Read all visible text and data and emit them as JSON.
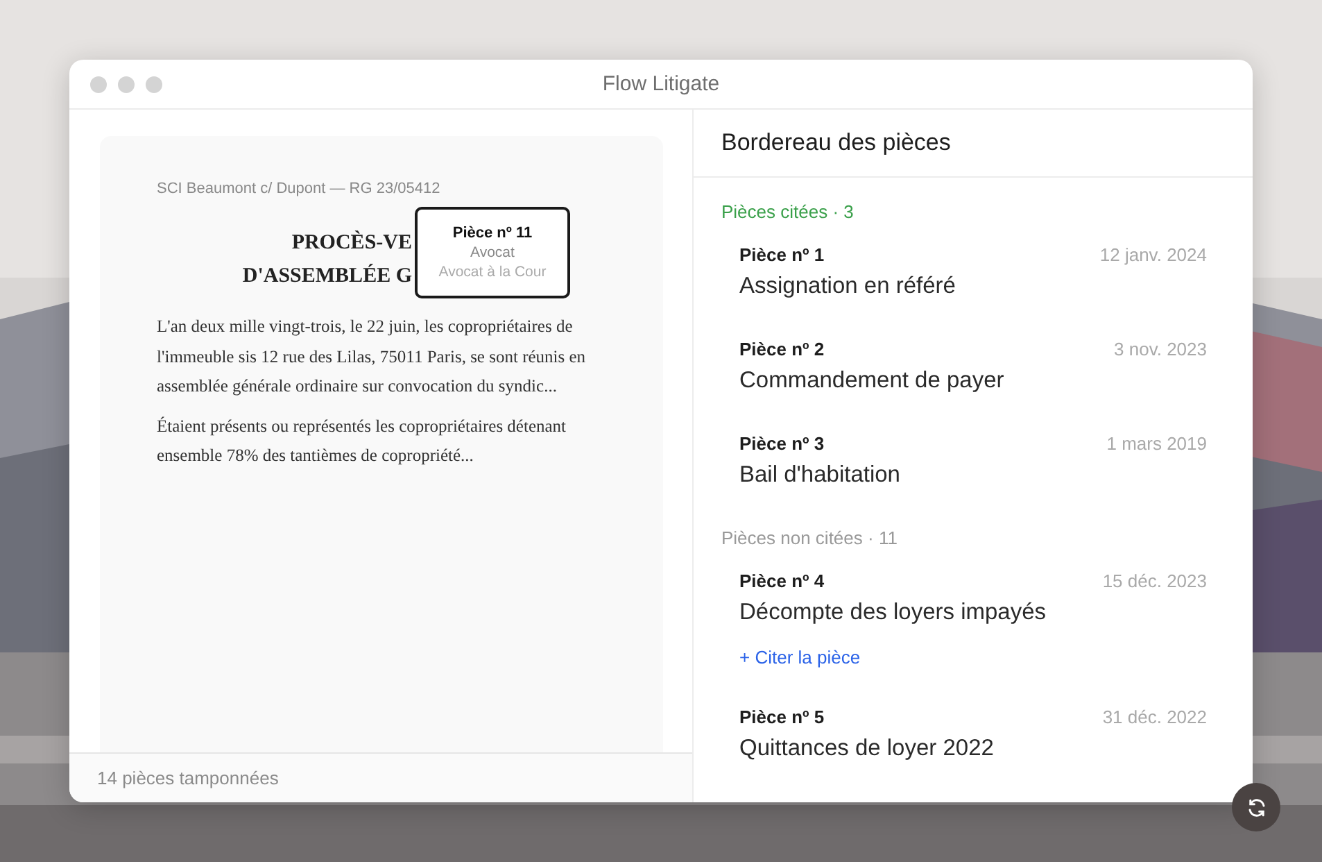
{
  "window": {
    "title": "Flow Litigate"
  },
  "document": {
    "case_line": "SCI Beaumont c/ Dupont — RG 23/05412",
    "title_lines": [
      "PROCÈS-VE",
      "D'ASSEMBLÉE G"
    ],
    "paragraphs": [
      "L'an deux mille vingt-trois, le 22 juin, les copropriétaires de l'immeuble sis 12 rue des Lilas, 75011 Paris, se sont réunis en assemblée générale ordinaire sur convocation du syndic...",
      "Étaient présents ou représentés les copropriétaires détenant ensemble 78% des tantièmes de copropriété..."
    ]
  },
  "stamp": {
    "title": "Pièce nº 11",
    "role": "Avocat",
    "subtitle": "Avocat à la Cour"
  },
  "status_bar": "14 pièces tamponnées",
  "panel": {
    "title": "Bordereau des pièces",
    "sections": [
      {
        "label": "Pièces citées · 3",
        "cited": true,
        "items": [
          {
            "number": "Pièce nº 1",
            "date": "12 janv. 2024",
            "title": "Assignation en référé"
          },
          {
            "number": "Pièce nº 2",
            "date": "3 nov. 2023",
            "title": "Commandement de payer"
          },
          {
            "number": "Pièce nº 3",
            "date": "1 mars 2019",
            "title": "Bail d'habitation"
          }
        ]
      },
      {
        "label": "Pièces non citées · 11",
        "cited": false,
        "items": [
          {
            "number": "Pièce nº 4",
            "date": "15 déc. 2023",
            "title": "Décompte des loyers impayés",
            "action": "+ Citer la pièce"
          },
          {
            "number": "Pièce nº 5",
            "date": "31 déc. 2022",
            "title": "Quittances de loyer 2022"
          }
        ]
      }
    ]
  }
}
